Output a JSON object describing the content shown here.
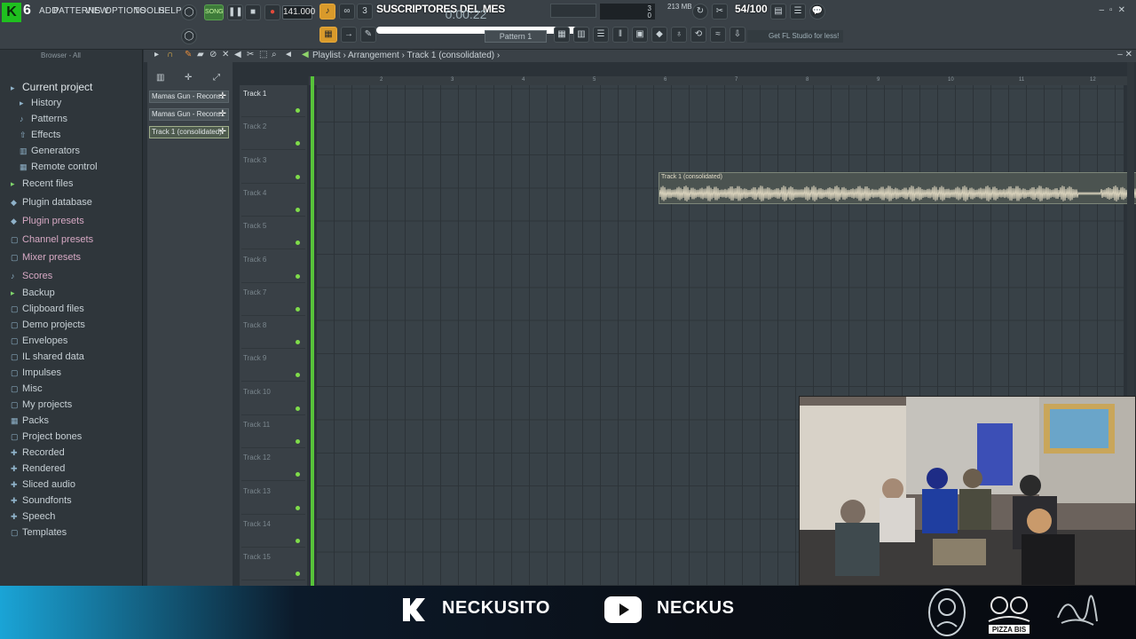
{
  "app": {
    "version_badge": "6"
  },
  "menu": {
    "items": [
      "ADD",
      "PATTERNS",
      "VIEW",
      "OPTIONS",
      "TOOLS",
      "HELP"
    ]
  },
  "transport": {
    "mode": "SONG",
    "tempo": "141.000",
    "time": "0:00:22"
  },
  "overlay": {
    "subscribers_title": "SUSCRIPTORES DEL MES",
    "goal_counter": "54/100"
  },
  "status": {
    "memory": "213 MB",
    "cpu": "3",
    "voices": "0",
    "pattern_selector": "Pattern 1",
    "hint": "Get FL Studio for less!"
  },
  "browser": {
    "header": "Browser - All",
    "items": [
      {
        "label": "Current project",
        "icon": "folder-open-icon",
        "level": 0
      },
      {
        "label": "History",
        "icon": "history-icon",
        "level": 1
      },
      {
        "label": "Patterns",
        "icon": "patterns-icon",
        "level": 1
      },
      {
        "label": "Effects",
        "icon": "effects-icon",
        "level": 1
      },
      {
        "label": "Generators",
        "icon": "generators-icon",
        "level": 1
      },
      {
        "label": "Remote control",
        "icon": "remote-control-icon",
        "level": 1
      },
      {
        "label": "Recent files",
        "icon": "recent-files-icon",
        "level": 0
      },
      {
        "label": "Plugin database",
        "icon": "plugin-database-icon",
        "level": 0
      },
      {
        "label": "Plugin presets",
        "icon": "plugin-presets-icon",
        "level": 0
      },
      {
        "label": "Channel presets",
        "icon": "channel-presets-icon",
        "level": 0
      },
      {
        "label": "Mixer presets",
        "icon": "mixer-presets-icon",
        "level": 0
      },
      {
        "label": "Scores",
        "icon": "scores-icon",
        "level": 0
      },
      {
        "label": "Backup",
        "icon": "backup-icon",
        "level": 0
      },
      {
        "label": "Clipboard files",
        "icon": "folder-icon",
        "level": 0
      },
      {
        "label": "Demo projects",
        "icon": "folder-icon",
        "level": 0
      },
      {
        "label": "Envelopes",
        "icon": "folder-icon",
        "level": 0
      },
      {
        "label": "IL shared data",
        "icon": "folder-icon",
        "level": 0
      },
      {
        "label": "Impulses",
        "icon": "folder-icon",
        "level": 0
      },
      {
        "label": "Misc",
        "icon": "folder-icon",
        "level": 0
      },
      {
        "label": "My projects",
        "icon": "folder-icon",
        "level": 0
      },
      {
        "label": "Packs",
        "icon": "packs-icon",
        "level": 0
      },
      {
        "label": "Project bones",
        "icon": "folder-icon",
        "level": 0
      },
      {
        "label": "Recorded",
        "icon": "recorded-icon",
        "level": 0
      },
      {
        "label": "Rendered",
        "icon": "rendered-icon",
        "level": 0
      },
      {
        "label": "Sliced audio",
        "icon": "sliced-audio-icon",
        "level": 0
      },
      {
        "label": "Soundfonts",
        "icon": "soundfonts-icon",
        "level": 0
      },
      {
        "label": "Speech",
        "icon": "speech-icon",
        "level": 0
      },
      {
        "label": "Templates",
        "icon": "folder-icon",
        "level": 0
      }
    ]
  },
  "picker": {
    "items": [
      {
        "label": "Mamas Gun - Recons..",
        "selected": false
      },
      {
        "label": "Mamas Gun - Recons..",
        "selected": false
      },
      {
        "label": "Track 1 (consolidated)",
        "selected": true
      }
    ]
  },
  "playlist": {
    "breadcrumb": "Playlist › Arrangement › Track 1 (consolidated) ›",
    "tracks": [
      "Track 1",
      "Track 2",
      "Track 3",
      "Track 4",
      "Track 5",
      "Track 6",
      "Track 7",
      "Track 8",
      "Track 9",
      "Track 10",
      "Track 11",
      "Track 12",
      "Track 13",
      "Track 14",
      "Track 15"
    ],
    "bars": [
      "2",
      "3",
      "4",
      "5",
      "6",
      "7",
      "8",
      "9",
      "10",
      "11",
      "12"
    ],
    "clip": {
      "label": "Track 1 (consolidated)"
    }
  },
  "stream": {
    "kick_handle": "NECKUSITO",
    "youtube_handle": "NECKUS",
    "sponsor": "PIZZA BIS"
  },
  "colors": {
    "accent_green": "#57c33a",
    "toolbar": "#3a4147",
    "clip": "#4b5350"
  }
}
